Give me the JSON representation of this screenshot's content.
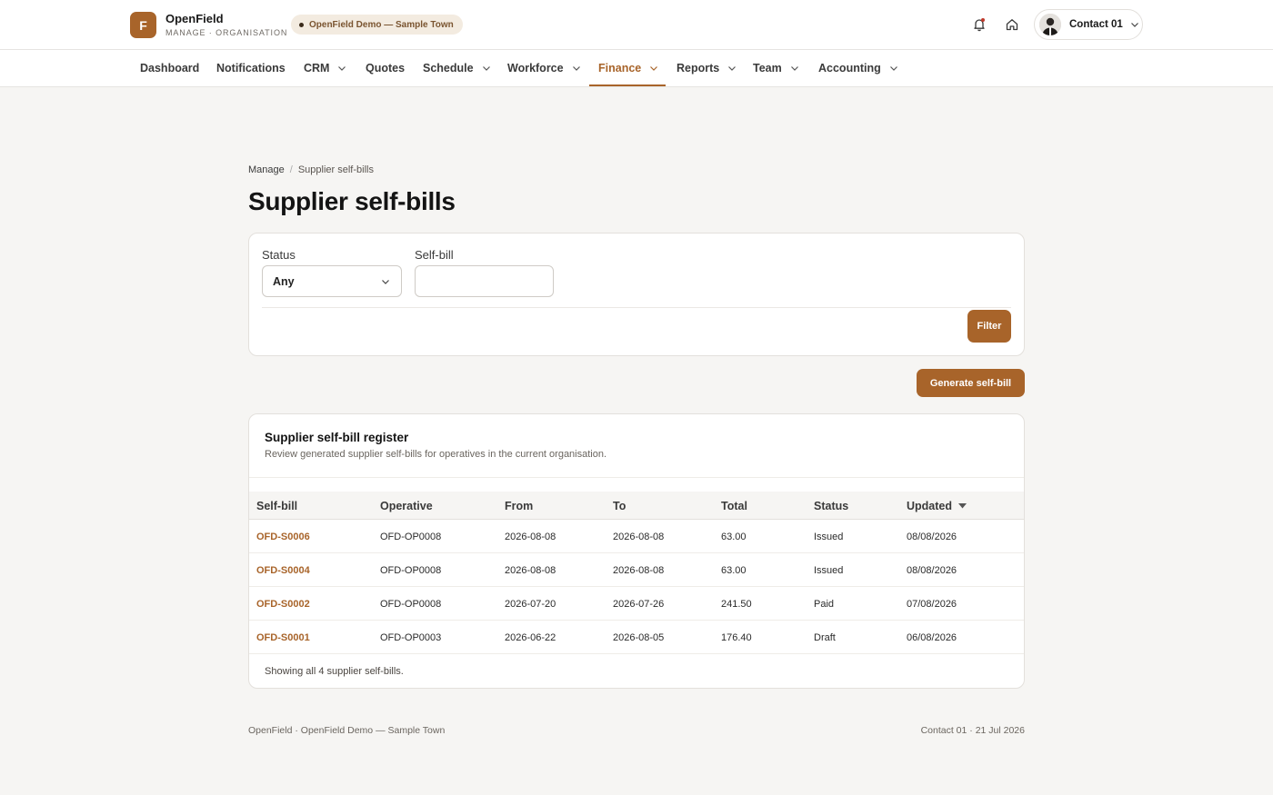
{
  "header": {
    "logo_letter": "F",
    "brand_name": "OpenField",
    "brand_sub": "MANAGE · ORGANISATION",
    "org_pill": "OpenField Demo — Sample Town",
    "user_name": "Contact 01"
  },
  "nav": {
    "items": [
      {
        "label": "Dashboard",
        "dropdown": false,
        "active": false
      },
      {
        "label": "Notifications",
        "dropdown": false,
        "active": false
      },
      {
        "label": "CRM",
        "dropdown": true,
        "active": false
      },
      {
        "label": "Quotes",
        "dropdown": false,
        "active": false
      },
      {
        "label": "Schedule",
        "dropdown": true,
        "active": false
      },
      {
        "label": "Workforce",
        "dropdown": true,
        "active": false
      },
      {
        "label": "Finance",
        "dropdown": true,
        "active": true
      },
      {
        "label": "Reports",
        "dropdown": true,
        "active": false
      },
      {
        "label": "Team",
        "dropdown": true,
        "active": false
      },
      {
        "label": "Accounting",
        "dropdown": true,
        "active": false
      }
    ]
  },
  "breadcrumb": {
    "root": "Manage",
    "separator": "/",
    "current": "Supplier self-bills"
  },
  "page": {
    "title": "Supplier self-bills"
  },
  "filters": {
    "status_label": "Status",
    "status_value": "Any",
    "selfbill_label": "Self-bill",
    "selfbill_value": "",
    "filter_button": "Filter"
  },
  "actions": {
    "generate_button": "Generate self-bill"
  },
  "register": {
    "title": "Supplier self-bill register",
    "subtitle": "Review generated supplier self-bills for operatives in the current organisation.",
    "columns": [
      "Self-bill",
      "Operative",
      "From",
      "To",
      "Total",
      "Status",
      "Updated"
    ],
    "sorted_column": "Updated",
    "rows": [
      {
        "selfbill": "OFD-S0006",
        "operative": "OFD-OP0008",
        "from": "2026-08-08",
        "to": "2026-08-08",
        "total": "63.00",
        "status": "Issued",
        "updated": "08/08/2026"
      },
      {
        "selfbill": "OFD-S0004",
        "operative": "OFD-OP0008",
        "from": "2026-08-08",
        "to": "2026-08-08",
        "total": "63.00",
        "status": "Issued",
        "updated": "08/08/2026"
      },
      {
        "selfbill": "OFD-S0002",
        "operative": "OFD-OP0008",
        "from": "2026-07-20",
        "to": "2026-07-26",
        "total": "241.50",
        "status": "Paid",
        "updated": "07/08/2026"
      },
      {
        "selfbill": "OFD-S0001",
        "operative": "OFD-OP0003",
        "from": "2026-06-22",
        "to": "2026-08-05",
        "total": "176.40",
        "status": "Draft",
        "updated": "06/08/2026"
      }
    ],
    "footer": "Showing all 4 supplier self-bills."
  },
  "footer": {
    "left": "OpenField · OpenField Demo — Sample Town",
    "right": "Contact 01 · 21 Jul 2026"
  },
  "colors": {
    "accent": "#a8642a",
    "background": "#f6f5f3",
    "card": "#ffffff"
  }
}
